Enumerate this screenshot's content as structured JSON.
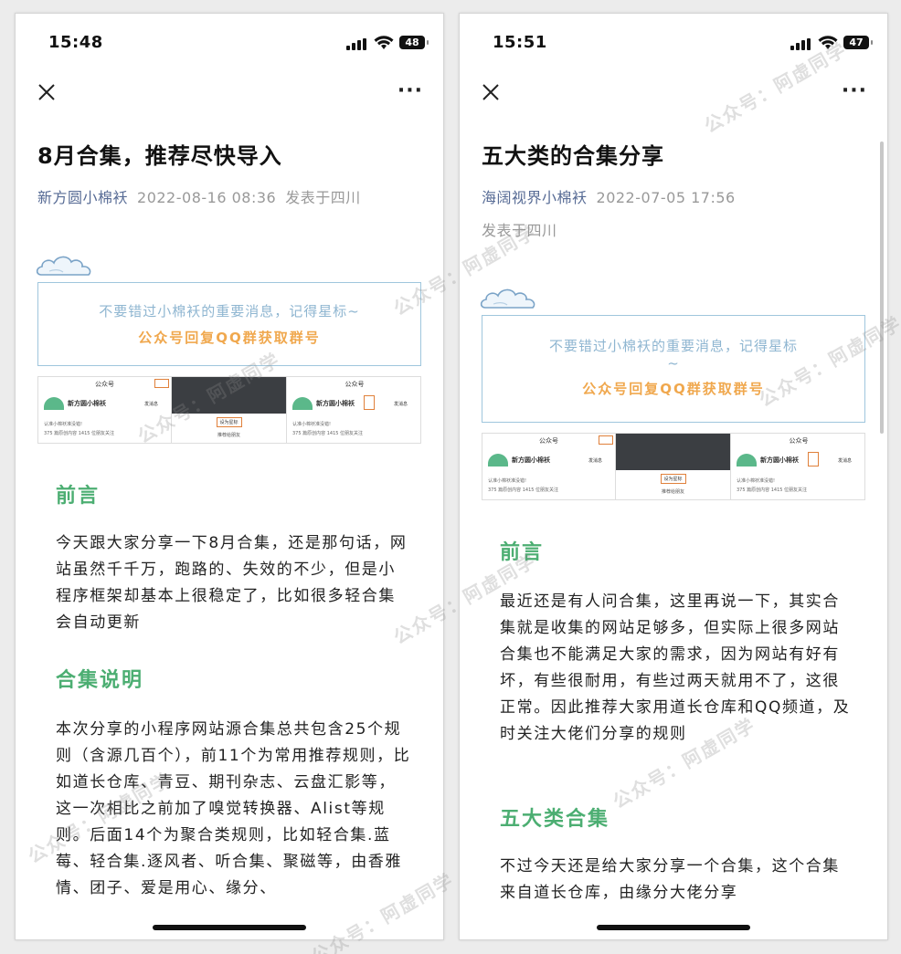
{
  "left": {
    "status": {
      "time": "15:48",
      "battery": "48"
    },
    "nav": {
      "more": "···"
    },
    "article": {
      "title": "8月合集，推荐尽快导入",
      "author": "新方圆小棉袄",
      "date": "2022-08-16 08:36",
      "location": "发表于四川"
    },
    "notice": {
      "line1": "不要错过小棉袄的重要消息，记得星标~",
      "line2": "公众号回复QQ群获取群号"
    },
    "shot": {
      "header": "公众号",
      "name": "新方圆小棉袄",
      "sub1": "认准小棉袄准没错!",
      "sub2": "375 篇原创内容  1415 位朋友关注",
      "star_btn": "设为星标",
      "share_btn": "推荐给朋友",
      "msg_btn": "发消息"
    },
    "sections": [
      {
        "heading": "前言",
        "body": "今天跟大家分享一下8月合集，还是那句话，网站虽然千千万，跑路的、失效的不少，但是小程序框架却基本上很稳定了，比如很多轻合集会自动更新"
      },
      {
        "heading": "合集说明",
        "body": "本次分享的小程序网站源合集总共包含25个规则（含源几百个），前11个为常用推荐规则，比如道长仓库、青豆、期刊杂志、云盘汇影等，这一次相比之前加了嗅觉转换器、Alist等规则。后面14个为聚合类规则，比如轻合集.蓝莓、轻合集.逐风者、听合集、聚磁等，由香雅情、团子、爱是用心、缘分、"
      }
    ]
  },
  "right": {
    "status": {
      "time": "15:51",
      "battery": "47"
    },
    "nav": {
      "more": "···"
    },
    "article": {
      "title": "五大类的合集分享",
      "author": "海阔视界小棉袄",
      "date": "2022-07-05 17:56",
      "location": "发表于四川"
    },
    "notice": {
      "line1": "不要错过小棉袄的重要消息，记得星标",
      "line1b": "~",
      "line2": "公众号回复QQ群获取群号"
    },
    "shot": {
      "header": "公众号",
      "name": "新方圆小棉袄",
      "sub1": "认准小棉袄准没错!",
      "sub2": "375 篇原创内容  1415 位朋友关注",
      "star_btn": "设为星标",
      "share_btn": "推荐给朋友",
      "msg_btn": "发消息"
    },
    "sections": [
      {
        "heading": "前言",
        "body": "最近还是有人问合集，这里再说一下，其实合集就是收集的网站足够多，但实际上很多网站合集也不能满足大家的需求，因为网站有好有坏，有些很耐用，有些过两天就用不了，这很正常。因此推荐大家用道长仓库和QQ频道，及时关注大佬们分享的规则"
      },
      {
        "heading": "五大类合集",
        "body": "不过今天还是给大家分享一个合集，这个合集来自道长仓库，由缘分大佬分享"
      }
    ]
  },
  "watermark": "公众号：阿虚同学",
  "colors": {
    "accent_green": "#4cae72",
    "author_blue": "#576b95",
    "notice_orange": "#f0a84e",
    "notice_blue": "#8fb6d1"
  },
  "icons": [
    "close-icon",
    "more-icon",
    "signal-icon",
    "wifi-icon",
    "battery-icon",
    "cloud-icon"
  ]
}
